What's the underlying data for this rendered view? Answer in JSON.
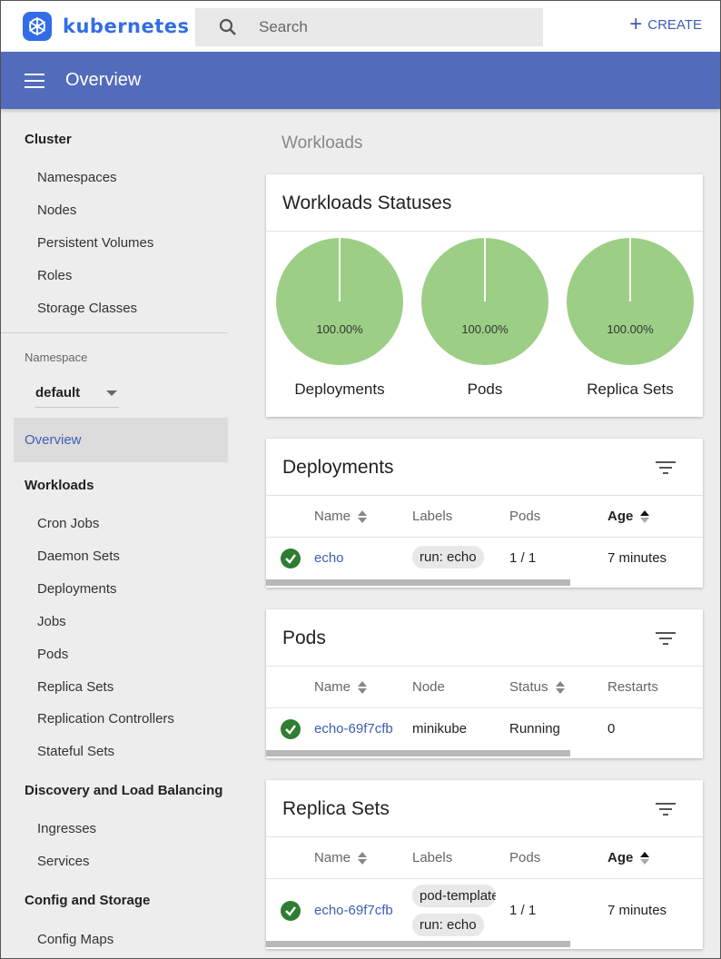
{
  "header": {
    "logo_text": "kubernetes",
    "search_placeholder": "Search",
    "create_label": "CREATE",
    "page_title": "Overview"
  },
  "sidebar": {
    "cluster": {
      "title": "Cluster",
      "items": [
        "Namespaces",
        "Nodes",
        "Persistent Volumes",
        "Roles",
        "Storage Classes"
      ]
    },
    "namespace": {
      "label": "Namespace",
      "value": "default"
    },
    "overview": "Overview",
    "workloads": {
      "title": "Workloads",
      "items": [
        "Cron Jobs",
        "Daemon Sets",
        "Deployments",
        "Jobs",
        "Pods",
        "Replica Sets",
        "Replication Controllers",
        "Stateful Sets"
      ]
    },
    "discovery": {
      "title": "Discovery and Load Balancing",
      "items": [
        "Ingresses",
        "Services"
      ]
    },
    "config": {
      "title": "Config and Storage",
      "items": [
        "Config Maps"
      ]
    }
  },
  "main": {
    "section_title": "Workloads",
    "statuses": {
      "title": "Workloads Statuses",
      "charts": [
        {
          "label": "Deployments",
          "percent": "100.00%",
          "fraction": 1.0
        },
        {
          "label": "Pods",
          "percent": "100.00%",
          "fraction": 1.0
        },
        {
          "label": "Replica Sets",
          "percent": "100.00%",
          "fraction": 1.0
        }
      ]
    },
    "deployments": {
      "title": "Deployments",
      "columns": [
        "Name",
        "Labels",
        "Pods",
        "Age"
      ],
      "rows": [
        {
          "name": "echo",
          "labels": [
            "run: echo"
          ],
          "pods": "1 / 1",
          "age": "7 minutes"
        }
      ]
    },
    "pods": {
      "title": "Pods",
      "columns": [
        "Name",
        "Node",
        "Status",
        "Restarts"
      ],
      "rows": [
        {
          "name": "echo-69f7cfb",
          "node": "minikube",
          "status": "Running",
          "restarts": "0"
        }
      ]
    },
    "replica_sets": {
      "title": "Replica Sets",
      "columns": [
        "Name",
        "Labels",
        "Pods",
        "Age"
      ],
      "rows": [
        {
          "name": "echo-69f7cfb",
          "labels": [
            "pod-template-hash",
            "run: echo"
          ],
          "pods": "1 / 1",
          "age": "7 minutes"
        }
      ]
    }
  },
  "colors": {
    "brand": "#326de6",
    "titlebar": "#526cbb",
    "pie_fill": "#9ccf85",
    "success": "#2e7d32"
  }
}
